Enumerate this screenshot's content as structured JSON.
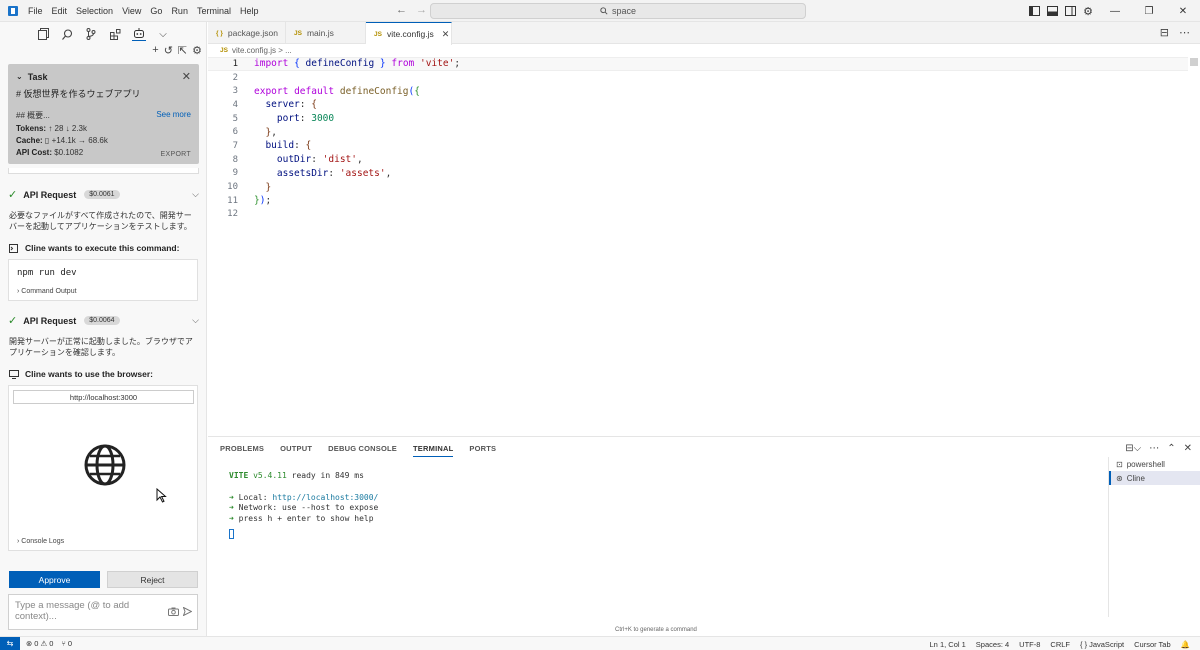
{
  "menu": [
    "File",
    "Edit",
    "Selection",
    "View",
    "Go",
    "Run",
    "Terminal",
    "Help"
  ],
  "search": {
    "text": "space"
  },
  "task": {
    "heading": "Task",
    "title": "# 仮想世界を作るウェブアプリ",
    "summary": "## 概要...",
    "see_more": "See more",
    "tokens_label": "Tokens:",
    "tokens_value": "↑ 28 ↓ 2.3k",
    "cache_label": "Cache:",
    "cache_value": "+14.1k → 68.6k",
    "cost_label": "API Cost:",
    "cost_value": "$0.1082",
    "export": "EXPORT"
  },
  "requests": [
    {
      "label": "API Request",
      "cost": "$0.0061",
      "message": "必要なファイルがすべて作成されたので、開発サーバーを起動してアプリケーションをテストします。"
    },
    {
      "label": "API Request",
      "cost": "$0.0064",
      "message": "開発サーバーが正常に起動しました。ブラウザでアプリケーションを確認します。"
    }
  ],
  "command": {
    "heading": "Cline wants to execute this command:",
    "text": "npm run dev",
    "output_label": "Command Output"
  },
  "browser": {
    "heading": "Cline wants to use the browser:",
    "url": "http://localhost:3000",
    "console_label": "Console Logs"
  },
  "actions": {
    "approve": "Approve",
    "reject": "Reject"
  },
  "chat": {
    "placeholder": "Type a message (@ to add context)..."
  },
  "tabs": [
    {
      "icon": "{ }",
      "name": "package.json"
    },
    {
      "icon": "JS",
      "name": "main.js"
    },
    {
      "icon": "JS",
      "name": "vite.config.js"
    }
  ],
  "breadcrumb": {
    "icon": "JS",
    "file": "vite.config.js",
    "rest": "> ..."
  },
  "code": {
    "line_numbers": [
      "1",
      "2",
      "3",
      "4",
      "5",
      "6",
      "7",
      "8",
      "9",
      "10",
      "11",
      "12"
    ]
  },
  "panel": {
    "tabs": [
      "PROBLEMS",
      "OUTPUT",
      "DEBUG CONSOLE",
      "TERMINAL",
      "PORTS"
    ],
    "terminal": {
      "vite": "VITE",
      "version": "v5.4.11",
      "ready": "ready in 849 ms",
      "local_label": "Local:",
      "local_url": "http://localhost:3000/",
      "network": "Network: use --host to expose",
      "help": "press h + enter to show help"
    },
    "terminals": [
      "powershell",
      "Cline"
    ],
    "hint": "Ctrl+K to generate a command"
  },
  "status": {
    "errors": "0",
    "warnings": "0",
    "ports": "0",
    "position": "Ln 1, Col 1",
    "spaces": "Spaces: 4",
    "encoding": "UTF-8",
    "eol": "CRLF",
    "language": "JavaScript",
    "cursor_tab": "Cursor Tab"
  },
  "colors": {
    "accent": "#005fb8",
    "task_bg": "#c8c8c8",
    "success": "#2a8a2a"
  }
}
